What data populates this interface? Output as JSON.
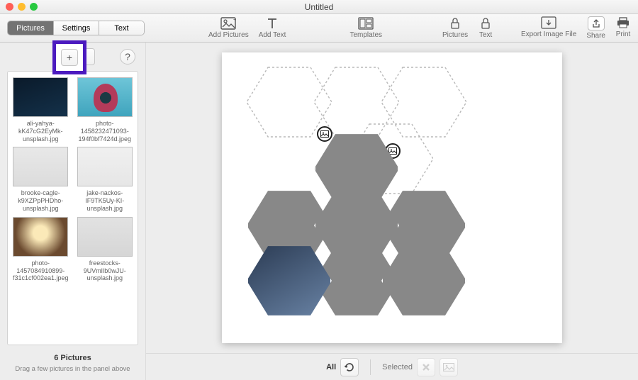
{
  "window": {
    "title": "Untitled"
  },
  "tabs": {
    "pictures": "Pictures",
    "settings": "Settings",
    "text": "Text"
  },
  "toolbar": {
    "addPictures": "Add Pictures",
    "addText": "Add Text",
    "templates": "Templates",
    "pictures": "Pictures",
    "text": "Text",
    "export": "Export Image File",
    "share": "Share",
    "print": "Print"
  },
  "sidebar": {
    "plus": "+",
    "minus": "−",
    "help": "?",
    "thumbs": [
      {
        "name": "ali-yahya-kK47cG2EyMk-unsplash.jpg"
      },
      {
        "name": "photo-1458232471093-194f0bf7424d.jpeg"
      },
      {
        "name": "brooke-cagle-k9XZPpPHDho-unsplash.jpg"
      },
      {
        "name": "jake-nackos-IF9TK5Uy-KI-unsplash.jpg"
      },
      {
        "name": "photo-1457084910899-f31c1cf002ea1.jpeg"
      },
      {
        "name": "freestocks-9UVmlIb0wJU-unsplash.jpg"
      }
    ],
    "count": "6 Pictures",
    "hint": "Drag a few pictures in the panel above"
  },
  "bottom": {
    "all": "All",
    "selected": "Selected"
  }
}
